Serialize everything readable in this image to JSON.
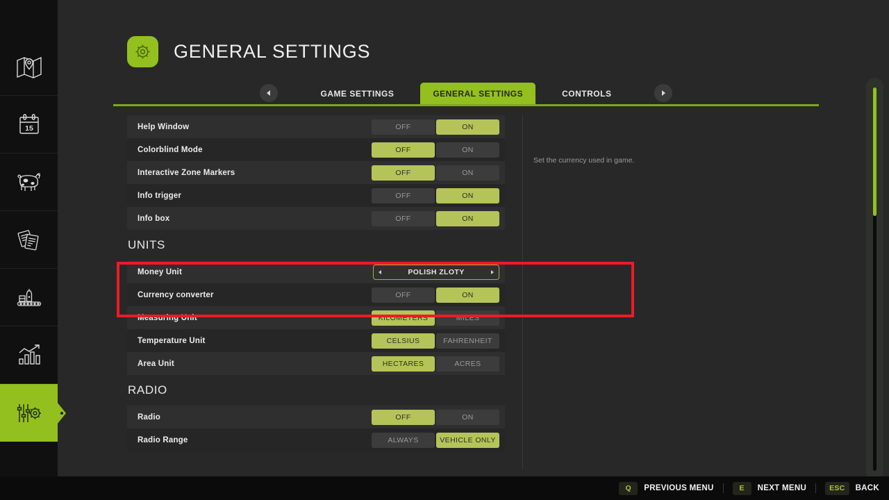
{
  "sidebar": {
    "items": [
      {
        "name": "map",
        "icon": "map-icon",
        "active": false
      },
      {
        "name": "calendar",
        "icon": "calendar-icon",
        "active": false,
        "day": "15"
      },
      {
        "name": "animals",
        "icon": "cow-icon",
        "active": false
      },
      {
        "name": "contracts",
        "icon": "documents-icon",
        "active": false
      },
      {
        "name": "production",
        "icon": "production-icon",
        "active": false
      },
      {
        "name": "statistics",
        "icon": "bar-chart-icon",
        "active": false
      },
      {
        "name": "settings",
        "icon": "settings-sliders-icon",
        "active": true
      }
    ]
  },
  "header": {
    "icon": "gear-icon",
    "title": "GENERAL SETTINGS"
  },
  "tabs": {
    "prev_arrow": "chevron-left-icon",
    "next_arrow": "chevron-right-icon",
    "items": [
      {
        "label": "GAME SETTINGS",
        "active": false
      },
      {
        "label": "GENERAL SETTINGS",
        "active": true
      },
      {
        "label": "CONTROLS",
        "active": false
      }
    ]
  },
  "settings": {
    "rows": [
      {
        "label": "Help Window",
        "type": "toggle",
        "options": [
          "OFF",
          "ON"
        ],
        "selected": 1
      },
      {
        "label": "Colorblind Mode",
        "type": "toggle",
        "options": [
          "OFF",
          "ON"
        ],
        "selected": 0
      },
      {
        "label": "Interactive Zone Markers",
        "type": "toggle",
        "options": [
          "OFF",
          "ON"
        ],
        "selected": 0
      },
      {
        "label": "Info trigger",
        "type": "toggle",
        "options": [
          "OFF",
          "ON"
        ],
        "selected": 1
      },
      {
        "label": "Info box",
        "type": "toggle",
        "options": [
          "OFF",
          "ON"
        ],
        "selected": 1
      }
    ],
    "units_heading": "UNITS",
    "units_rows": [
      {
        "label": "Money Unit",
        "type": "selector",
        "value": "POLISH ZLOTY"
      },
      {
        "label": "Currency converter",
        "type": "toggle",
        "options": [
          "OFF",
          "ON"
        ],
        "selected": 1
      },
      {
        "label": "Measuring Unit",
        "type": "toggle",
        "options": [
          "KILOMETERS",
          "MILES"
        ],
        "selected": 0
      },
      {
        "label": "Temperature Unit",
        "type": "toggle",
        "options": [
          "CELSIUS",
          "FAHRENHEIT"
        ],
        "selected": 0
      },
      {
        "label": "Area Unit",
        "type": "toggle",
        "options": [
          "HECTARES",
          "ACRES"
        ],
        "selected": 0
      }
    ],
    "radio_heading": "RADIO",
    "radio_rows": [
      {
        "label": "Radio",
        "type": "toggle",
        "options": [
          "OFF",
          "ON"
        ],
        "selected": 0
      },
      {
        "label": "Radio Range",
        "type": "toggle",
        "options": [
          "ALWAYS",
          "VEHICLE ONLY"
        ],
        "selected": 1
      }
    ]
  },
  "tooltip": {
    "text": "Set the currency used in game."
  },
  "bottom_bar": {
    "hints": [
      {
        "key": "Q",
        "label": "PREVIOUS MENU"
      },
      {
        "key": "E",
        "label": "NEXT MENU"
      },
      {
        "key": "ESC",
        "label": "BACK"
      }
    ]
  },
  "colors": {
    "accent_green": "#93c01f",
    "toggle_on": "#b5c458",
    "highlight_red": "#ee1b24",
    "panel_bg": "#282828",
    "sidebar_bg": "#101010"
  }
}
